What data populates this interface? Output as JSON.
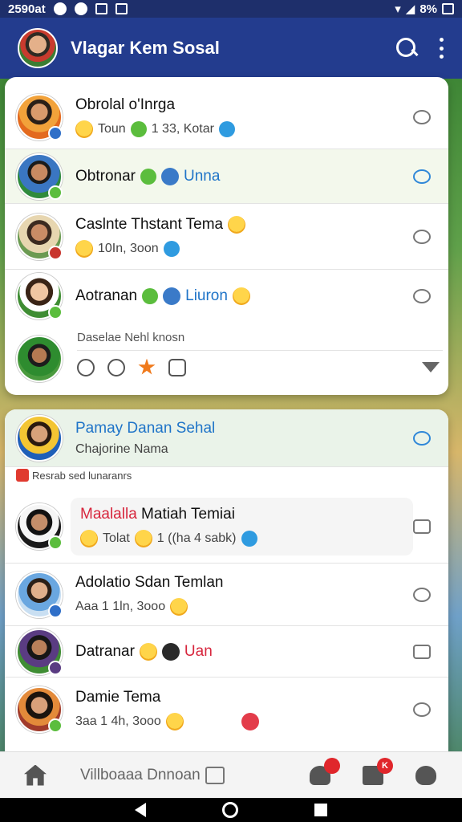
{
  "status_bar": {
    "time": "2590at",
    "battery": "8%"
  },
  "app_bar": {
    "title": "Vlagar Kem Sosal"
  },
  "card1": {
    "rows": [
      {
        "name": "Obrolal o'Inrga",
        "sub": "Toun",
        "sub2": "1 33, Kotar"
      },
      {
        "name": "Obtronar",
        "sub_inline": "Unna"
      },
      {
        "name": "Caslnte Thstant Tema",
        "sub": "10In, 3oon"
      },
      {
        "name": "Aotranan",
        "sub_inline": "Liuron"
      }
    ],
    "section_label": "Daselae Nehl knosn"
  },
  "card2": {
    "header_row": {
      "name": "Pamay Danan Sehal",
      "sub": "Chajorine Nama"
    },
    "mini_label": "Resrab sed lunaranrs",
    "rows": [
      {
        "name_red": "Maalalla",
        "name": " Matiah Temiai",
        "sub": "Tolat",
        "sub2": "1 ((ha 4 sabk)"
      },
      {
        "name": "Adolatio Sdan Temlan",
        "sub": "Aaa 1 1ln, 3ooo"
      },
      {
        "name": "Datranar",
        "sub_inline": "Uan"
      },
      {
        "name": "Damie Tema",
        "sub": "3aa 1 4h, 3ooo"
      }
    ]
  },
  "bottom_nav": {
    "label": "Villboaaa Dnnoan",
    "badge1": "",
    "badge2": "K"
  },
  "colors": {
    "app_bar": "#233c8e",
    "accent": "#1f74c8",
    "red": "#d7263d"
  }
}
